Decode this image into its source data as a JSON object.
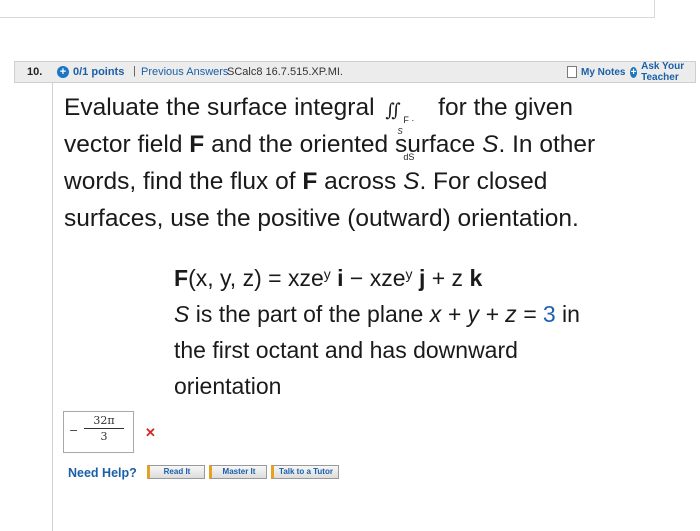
{
  "header": {
    "question_number": "10.",
    "points": "0/1 points",
    "separator": "|",
    "previous_answers": "Previous Answers",
    "problem_code": "SCalc8 16.7.515.XP.MI.",
    "my_notes": "My Notes",
    "ask_teacher": "Ask Your Teacher"
  },
  "question": {
    "line1_a": "Evaluate the surface integral",
    "integral_body": "F · dS",
    "integral_sub": "S",
    "line1_b": "for the given",
    "line2_a": "vector field",
    "line2_F": "F",
    "line2_b": "and the oriented surface",
    "line2_S": "S",
    "line2_c": ". In other",
    "line3_a": "words, find the flux of",
    "line3_F": "F",
    "line3_b": "across",
    "line3_S": "S",
    "line3_c": ". For closed",
    "line4": "surfaces, use the positive (outward) orientation."
  },
  "formula": {
    "F_label": "F",
    "args": "(x, y, z) = xze",
    "exp1": "y",
    "i": "i",
    "minus": " − xze",
    "exp2": "y",
    "j": "j",
    "plus": " + z ",
    "k": "k",
    "surface_a": "S",
    "surface_b": " is the part of the plane ",
    "plane": "x + y + z = ",
    "plane_value": "3",
    "surface_c": " in",
    "line3": "the first octant and has downward",
    "line4": "orientation"
  },
  "answer": {
    "sign": "−",
    "numerator": "32π",
    "denominator": "3",
    "status_icon": "incorrect-x-icon",
    "status_glyph": "✕"
  },
  "help": {
    "need_help": "Need Help?",
    "read_it": "Read It",
    "master_it": "Master It",
    "talk_tutor": "Talk to a Tutor"
  },
  "colors": {
    "link_blue": "#1b5fa8",
    "value_blue": "#1f5fb0",
    "incorrect_red": "#d22a2a",
    "header_bg": "#ececec"
  }
}
